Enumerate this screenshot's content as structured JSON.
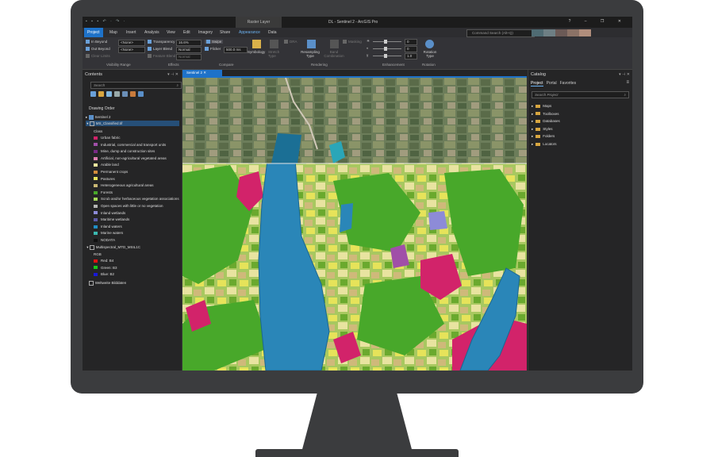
{
  "titlebar": {
    "quick_access": "▪ ▪ ▪ ↶ · ↷ ·",
    "context_tab": "Raster Layer",
    "title": "DL - Sentinel 2 - ArcGIS Pro",
    "window_buttons": "? – ❐ ✕"
  },
  "tabs": [
    "Project",
    "Map",
    "Insert",
    "Analysis",
    "View",
    "Edit",
    "Imagery",
    "Share",
    "Appearance",
    "Data"
  ],
  "active_tab": "Project",
  "context_tabs": [
    "Appearance",
    "Data"
  ],
  "command_search": "Command Search (Alt+Q)",
  "account_colors": [
    "#4f6b73",
    "#6e7f84",
    "#6b5a56",
    "#8b7266",
    "#b08e7c"
  ],
  "ribbon": {
    "visibility": {
      "in_beyond": "In Beyond",
      "out_beyond": "Out Beyond",
      "clear_limits": "Clear Limits",
      "in_value": "<None>",
      "out_value": "<None>",
      "group": "Visibility Range"
    },
    "effects": {
      "transparency_label": "Transparency",
      "transparency_value": "16.6%",
      "layer_blend_label": "Layer Blend",
      "layer_blend_value": "Normal",
      "feature_blend_label": "Feature Blend",
      "feature_blend_value": "Normal",
      "group": "Effects"
    },
    "compare": {
      "swipe": "Swipe",
      "flicker": "Flicker",
      "flicker_value": "500.0 ms",
      "group": "Compare"
    },
    "symbology": {
      "label": "Symbology",
      "stretch": "Stretch Type",
      "dra": "DRA"
    },
    "rendering": {
      "resampling": "Resampling Type",
      "band": "Band Combination",
      "masking": "Masking",
      "group": "Rendering"
    },
    "enhancement": {
      "values": [
        "0",
        "0",
        "1.0"
      ],
      "group": "Enhancement"
    },
    "rotation": {
      "label": "Rotation Type",
      "group": "Rotation"
    }
  },
  "contents": {
    "title": "Contents",
    "pane_buttons": "▾ ⊣ ✕",
    "search_placeholder": "Search",
    "drawing_order": "Drawing Order",
    "map_name": "Sentinel 2",
    "layer_classified": "MS_Classified.tif",
    "class_field": "Class",
    "classes": [
      {
        "label": "Urban fabric",
        "color": "#d2236a"
      },
      {
        "label": "Industrial, commercial and transport units",
        "color": "#a04fa8"
      },
      {
        "label": "Mine, dump and construction sites",
        "color": "#7a2a86"
      },
      {
        "label": "Artificial, non-agricultural vegetated areas",
        "color": "#e07fb2"
      },
      {
        "label": "Arable land",
        "color": "#f0ea9e"
      },
      {
        "label": "Permanent crops",
        "color": "#d28c3b"
      },
      {
        "label": "Pastures",
        "color": "#e6e35a"
      },
      {
        "label": "Heterogeneous agricultural areas",
        "color": "#c9b774"
      },
      {
        "label": "Forests",
        "color": "#48a82a"
      },
      {
        "label": "Scrub and/or herbaceous vegetation associations",
        "color": "#a6d85a"
      },
      {
        "label": "Open spaces with little or no vegetation",
        "color": "#b5b5b5"
      },
      {
        "label": "Inland wetlands",
        "color": "#8d8bd8"
      },
      {
        "label": "Maritime wetlands",
        "color": "#5d5aa8"
      },
      {
        "label": "Inland waters",
        "color": "#1f8fc6"
      },
      {
        "label": "Marine waters",
        "color": "#3bb8b0"
      },
      {
        "label": "NODATA",
        "color": "#111111"
      }
    ],
    "layer_multispectral": "Multispectral_MTD_MSIL1C",
    "rgb_label": "RGB",
    "bands": [
      {
        "label": "Red: B4",
        "color": "#e01010"
      },
      {
        "label": "Green: B3",
        "color": "#18c818"
      },
      {
        "label": "Blue: B2",
        "color": "#1818d8"
      }
    ],
    "basemap": "Weltweite Bilddaten"
  },
  "map": {
    "tab_label": "Sentinel 2"
  },
  "catalog": {
    "title": "Catalog",
    "pane_buttons": "▾ ⊣ ✕",
    "tabs": [
      "Project",
      "Portal",
      "Favorites"
    ],
    "search_placeholder": "Search Project",
    "items": [
      "Maps",
      "Toolboxes",
      "Databases",
      "Styles",
      "Folders",
      "Locators"
    ]
  }
}
